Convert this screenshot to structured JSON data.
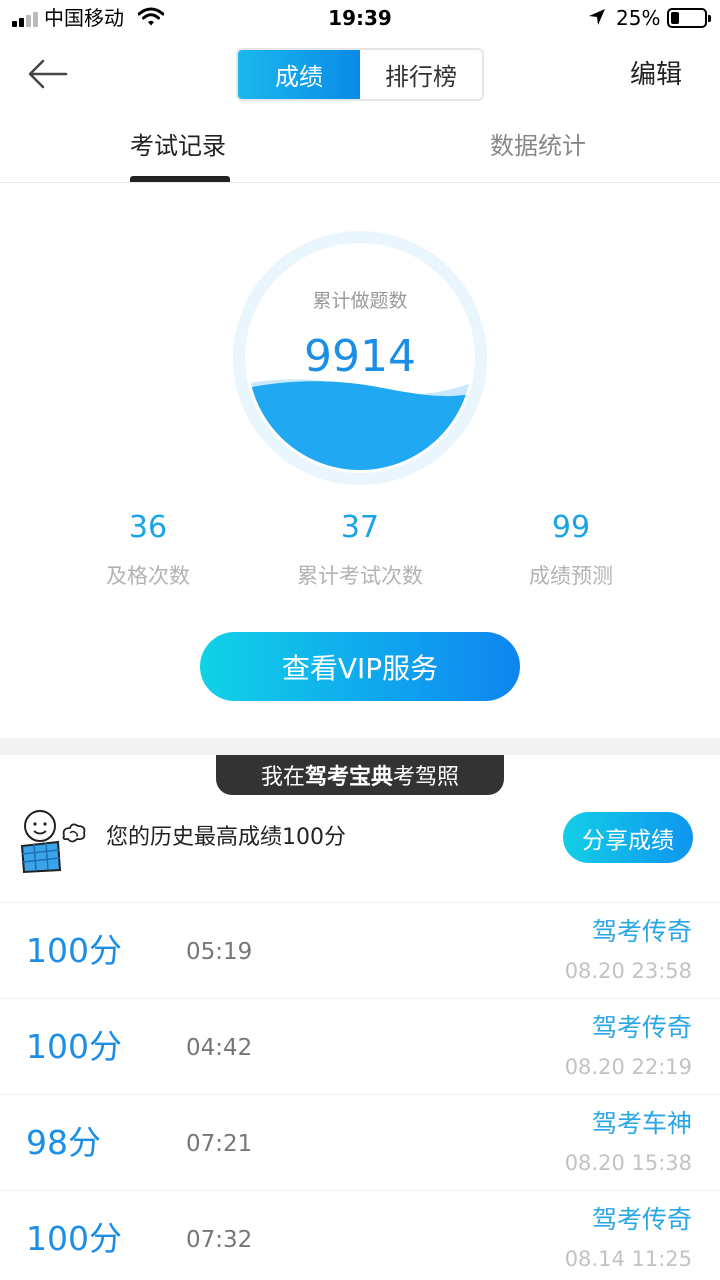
{
  "status_bar": {
    "carrier": "中国移动",
    "time": "19:39",
    "battery_percent": "25%",
    "battery_level": 0.25
  },
  "nav": {
    "tabs": [
      "成绩",
      "排行榜"
    ],
    "active_tab": 0,
    "edit_label": "编辑"
  },
  "sub_tabs": {
    "items": [
      "考试记录",
      "数据统计"
    ],
    "active": 0
  },
  "summary": {
    "total_label": "累计做题数",
    "total_value": "9914",
    "stats": [
      {
        "value": "36",
        "label": "及格次数"
      },
      {
        "value": "37",
        "label": "累计考试次数"
      },
      {
        "value": "99",
        "label": "成绩预测"
      }
    ],
    "vip_button": "查看VIP服务"
  },
  "banner": {
    "prefix": "我在",
    "brand": "驾考宝典",
    "suffix": "考驾照"
  },
  "history": {
    "best_text": "您的历史最高成绩100分",
    "share_button": "分享成绩"
  },
  "records": [
    {
      "score": "100分",
      "duration": "05:19",
      "title": "驾考传奇",
      "time": "08.20 23:58"
    },
    {
      "score": "100分",
      "duration": "04:42",
      "title": "驾考传奇",
      "time": "08.20 22:19"
    },
    {
      "score": "98分",
      "duration": "07:21",
      "title": "驾考车神",
      "time": "08.20 15:38"
    },
    {
      "score": "100分",
      "duration": "07:32",
      "title": "驾考传奇",
      "time": "08.14 11:25"
    }
  ],
  "colors": {
    "accent": "#1c8ee6",
    "accent_light": "#1aa3e8",
    "wave": "#21a8f2",
    "ring": "#eaf6fd"
  }
}
